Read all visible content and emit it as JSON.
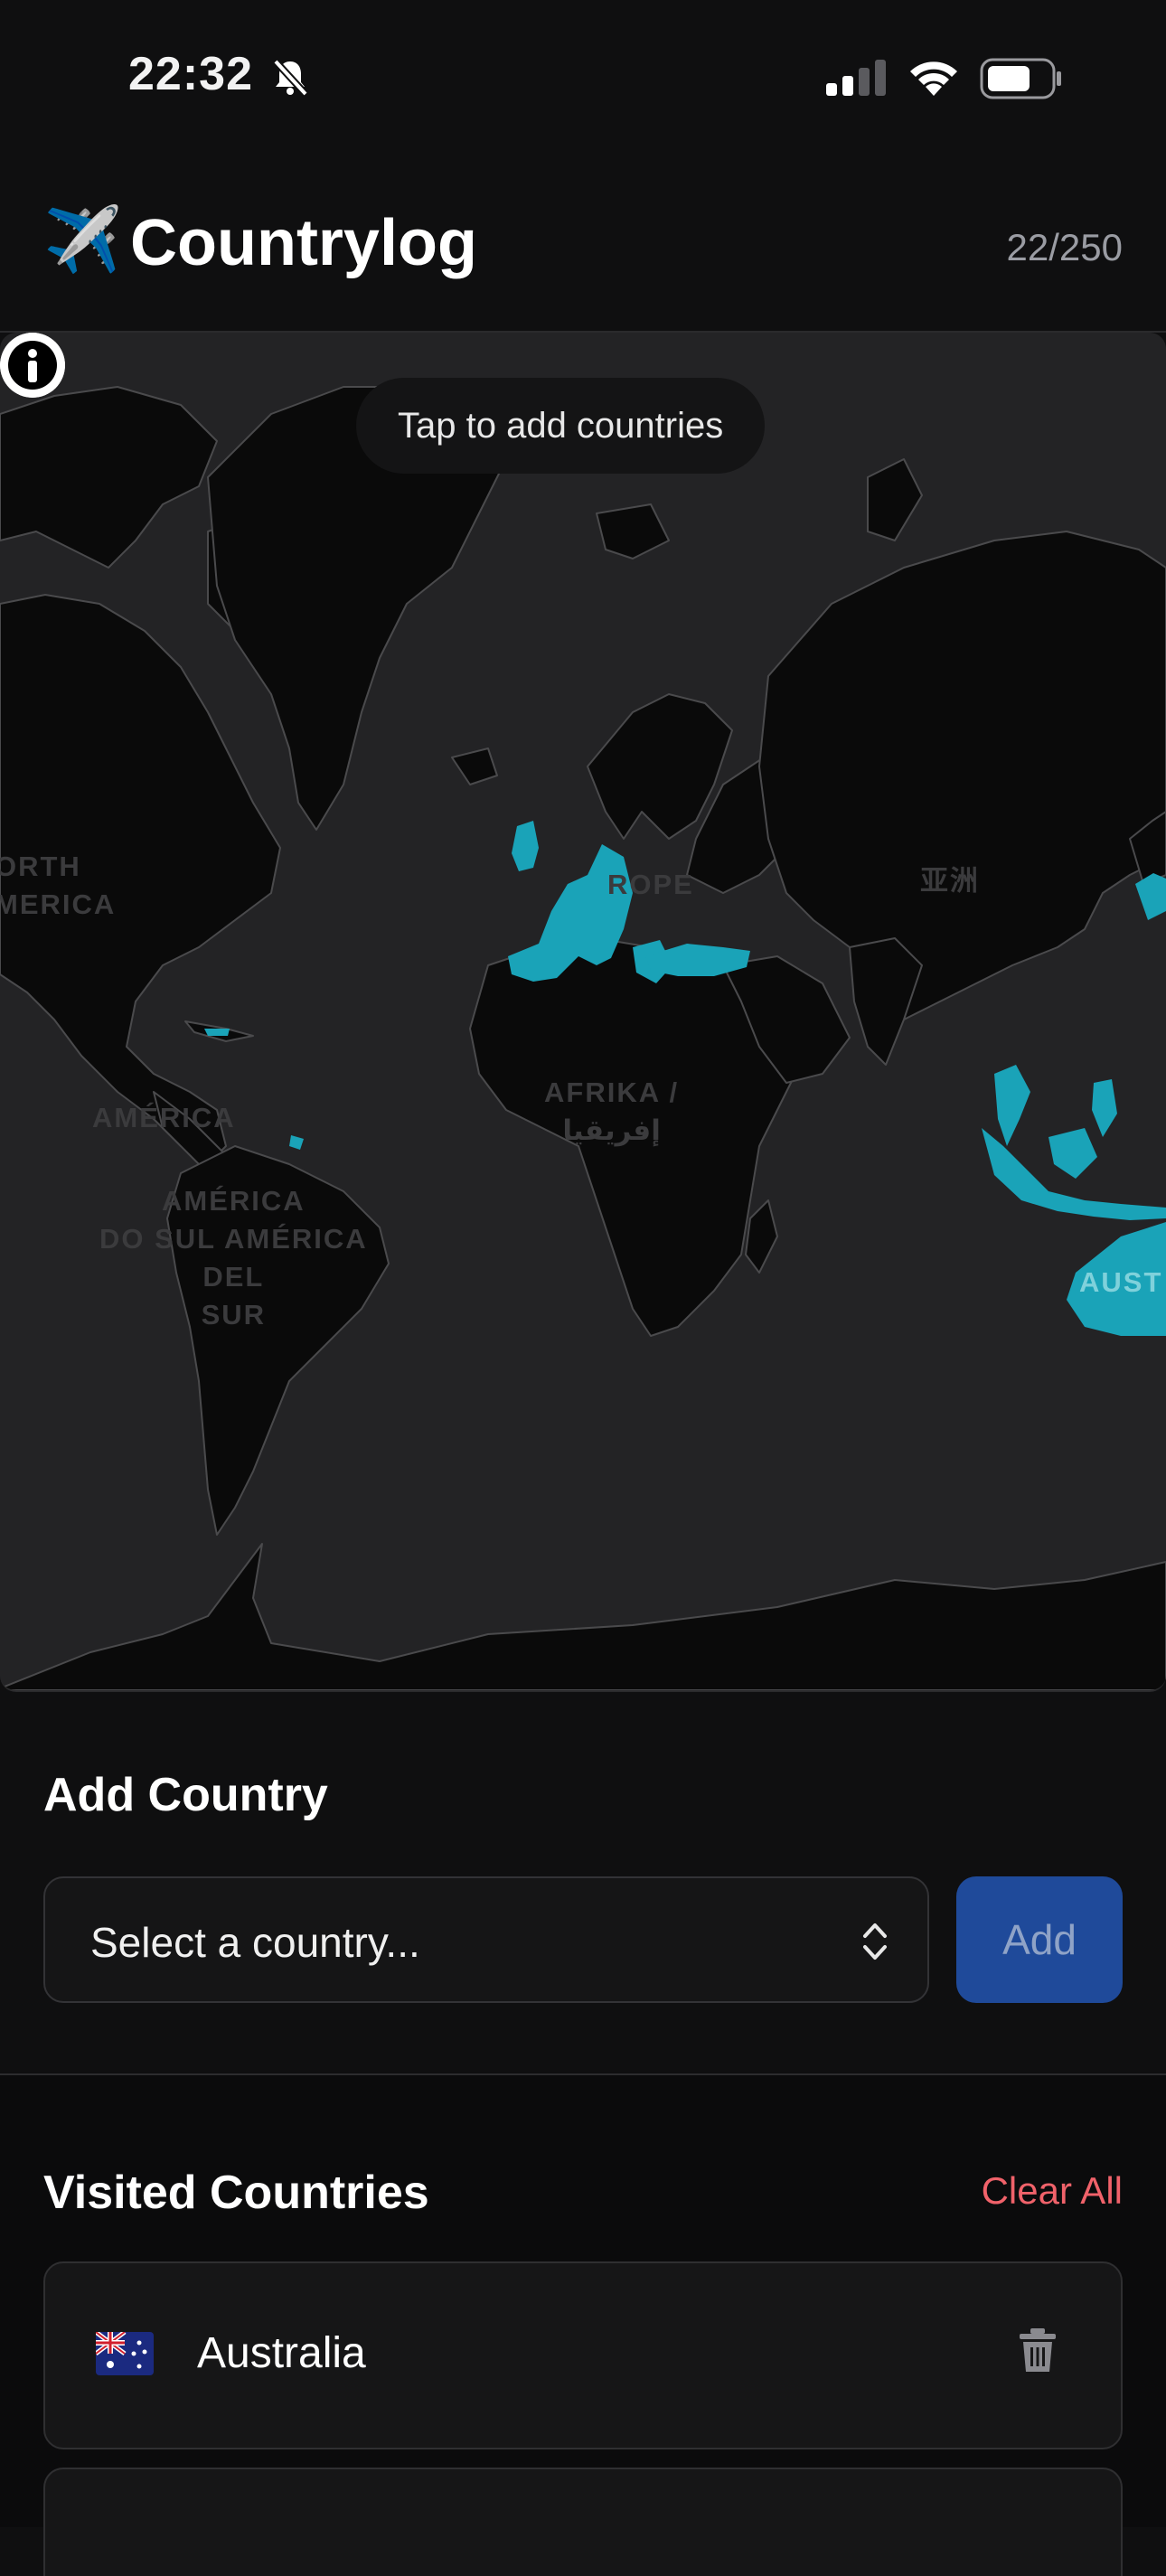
{
  "status_bar": {
    "time": "22:32"
  },
  "header": {
    "icon": "✈️",
    "title": "Countrylog",
    "counter": "22/250"
  },
  "map": {
    "hint": "Tap to add countries",
    "visited_color": "#1aa3b8",
    "labels": {
      "north_america": "ORTH\nMERICA",
      "central_america": "AMÉRICA",
      "south_america": "AMÉRICA\nDO SUL AMÉRICA\nDEL\nSUR",
      "europe": "ROPE",
      "africa": "AFRIKA /\nإفريقيا",
      "asia": "亚洲",
      "australia": "AUST"
    },
    "info_icon": "info-icon"
  },
  "add_country": {
    "title": "Add Country",
    "select_placeholder": "Select a country...",
    "add_label": "Add"
  },
  "visited": {
    "title": "Visited Countries",
    "clear_label": "Clear All",
    "items": [
      {
        "flag": "australia-flag",
        "name": "Australia"
      }
    ]
  },
  "colors": {
    "accent": "#1f4a9a",
    "danger": "#f0626a",
    "visited": "#1aa3b8"
  }
}
